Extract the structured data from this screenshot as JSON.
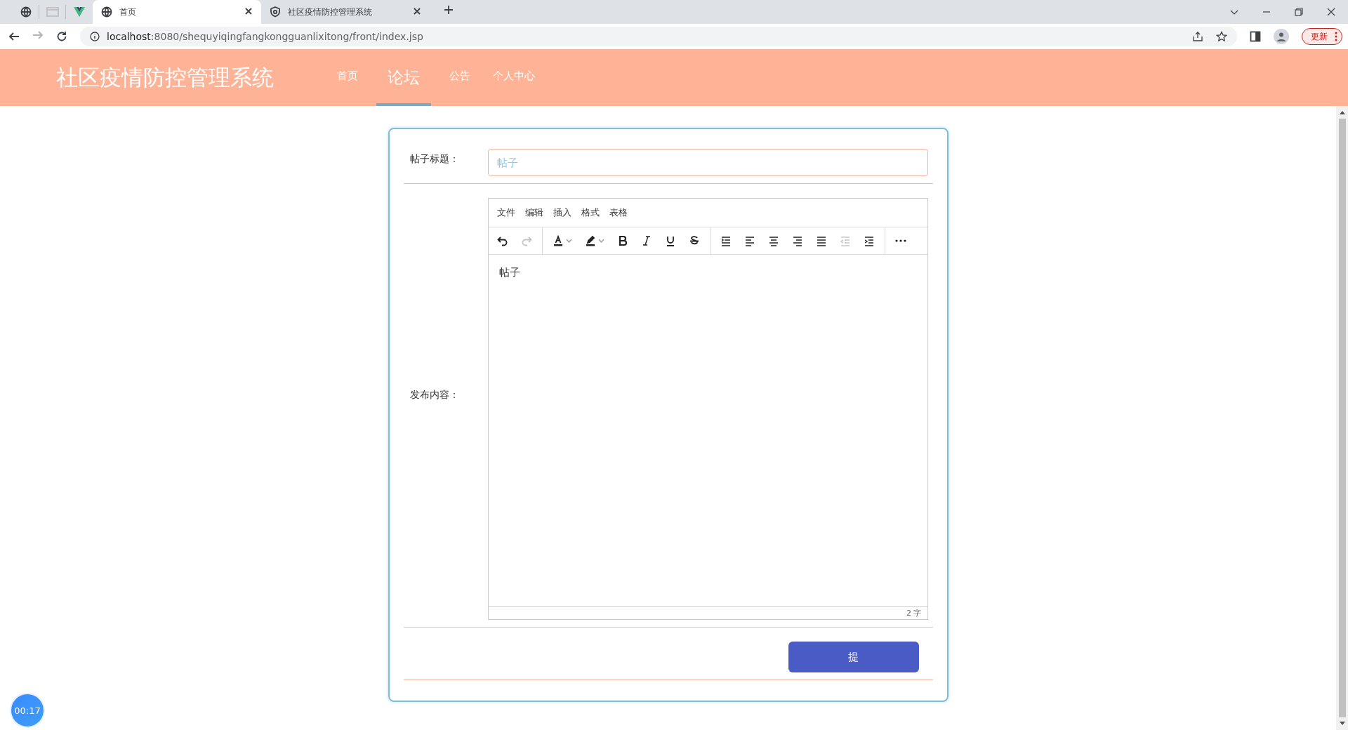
{
  "browser": {
    "tabs": [
      {
        "title": "首页",
        "selected": true
      },
      {
        "title": "社区疫情防控管理系统",
        "selected": false
      }
    ],
    "url_host": "localhost",
    "url_rest": ":8080/shequyiqingfangkongguanlixitong/front/index.jsp",
    "update_button": "更新"
  },
  "header": {
    "title": "社区疫情防控管理系统",
    "nav": [
      {
        "label": "首页",
        "selected": false
      },
      {
        "label": "论坛",
        "selected": true
      },
      {
        "label": "公告",
        "selected": false
      },
      {
        "label": "个人中心",
        "selected": false
      }
    ]
  },
  "form": {
    "title_label": "帖子标题：",
    "title_placeholder": "帖子",
    "content_label": "发布内容：",
    "menu": [
      "文件",
      "编辑",
      "插入",
      "格式",
      "表格"
    ],
    "toolbar": [
      {
        "kind": "undo",
        "disabled": false
      },
      {
        "kind": "redo",
        "disabled": true
      },
      {
        "kind": "separator"
      },
      {
        "kind": "text-color",
        "disabled": false
      },
      {
        "kind": "highlight",
        "disabled": false
      },
      {
        "kind": "bold",
        "disabled": false
      },
      {
        "kind": "italic",
        "disabled": false
      },
      {
        "kind": "underline",
        "disabled": false
      },
      {
        "kind": "strike",
        "disabled": false
      },
      {
        "kind": "separator"
      },
      {
        "kind": "line-height",
        "disabled": false
      },
      {
        "kind": "align-left",
        "disabled": false
      },
      {
        "kind": "align-center",
        "disabled": false
      },
      {
        "kind": "align-right",
        "disabled": false
      },
      {
        "kind": "justify",
        "disabled": false
      },
      {
        "kind": "outdent",
        "disabled": true
      },
      {
        "kind": "indent",
        "disabled": false
      },
      {
        "kind": "separator"
      },
      {
        "kind": "more",
        "disabled": false
      }
    ],
    "content": "帖子",
    "word_count": "2 字",
    "submit": "提"
  },
  "timer": "00:17"
}
